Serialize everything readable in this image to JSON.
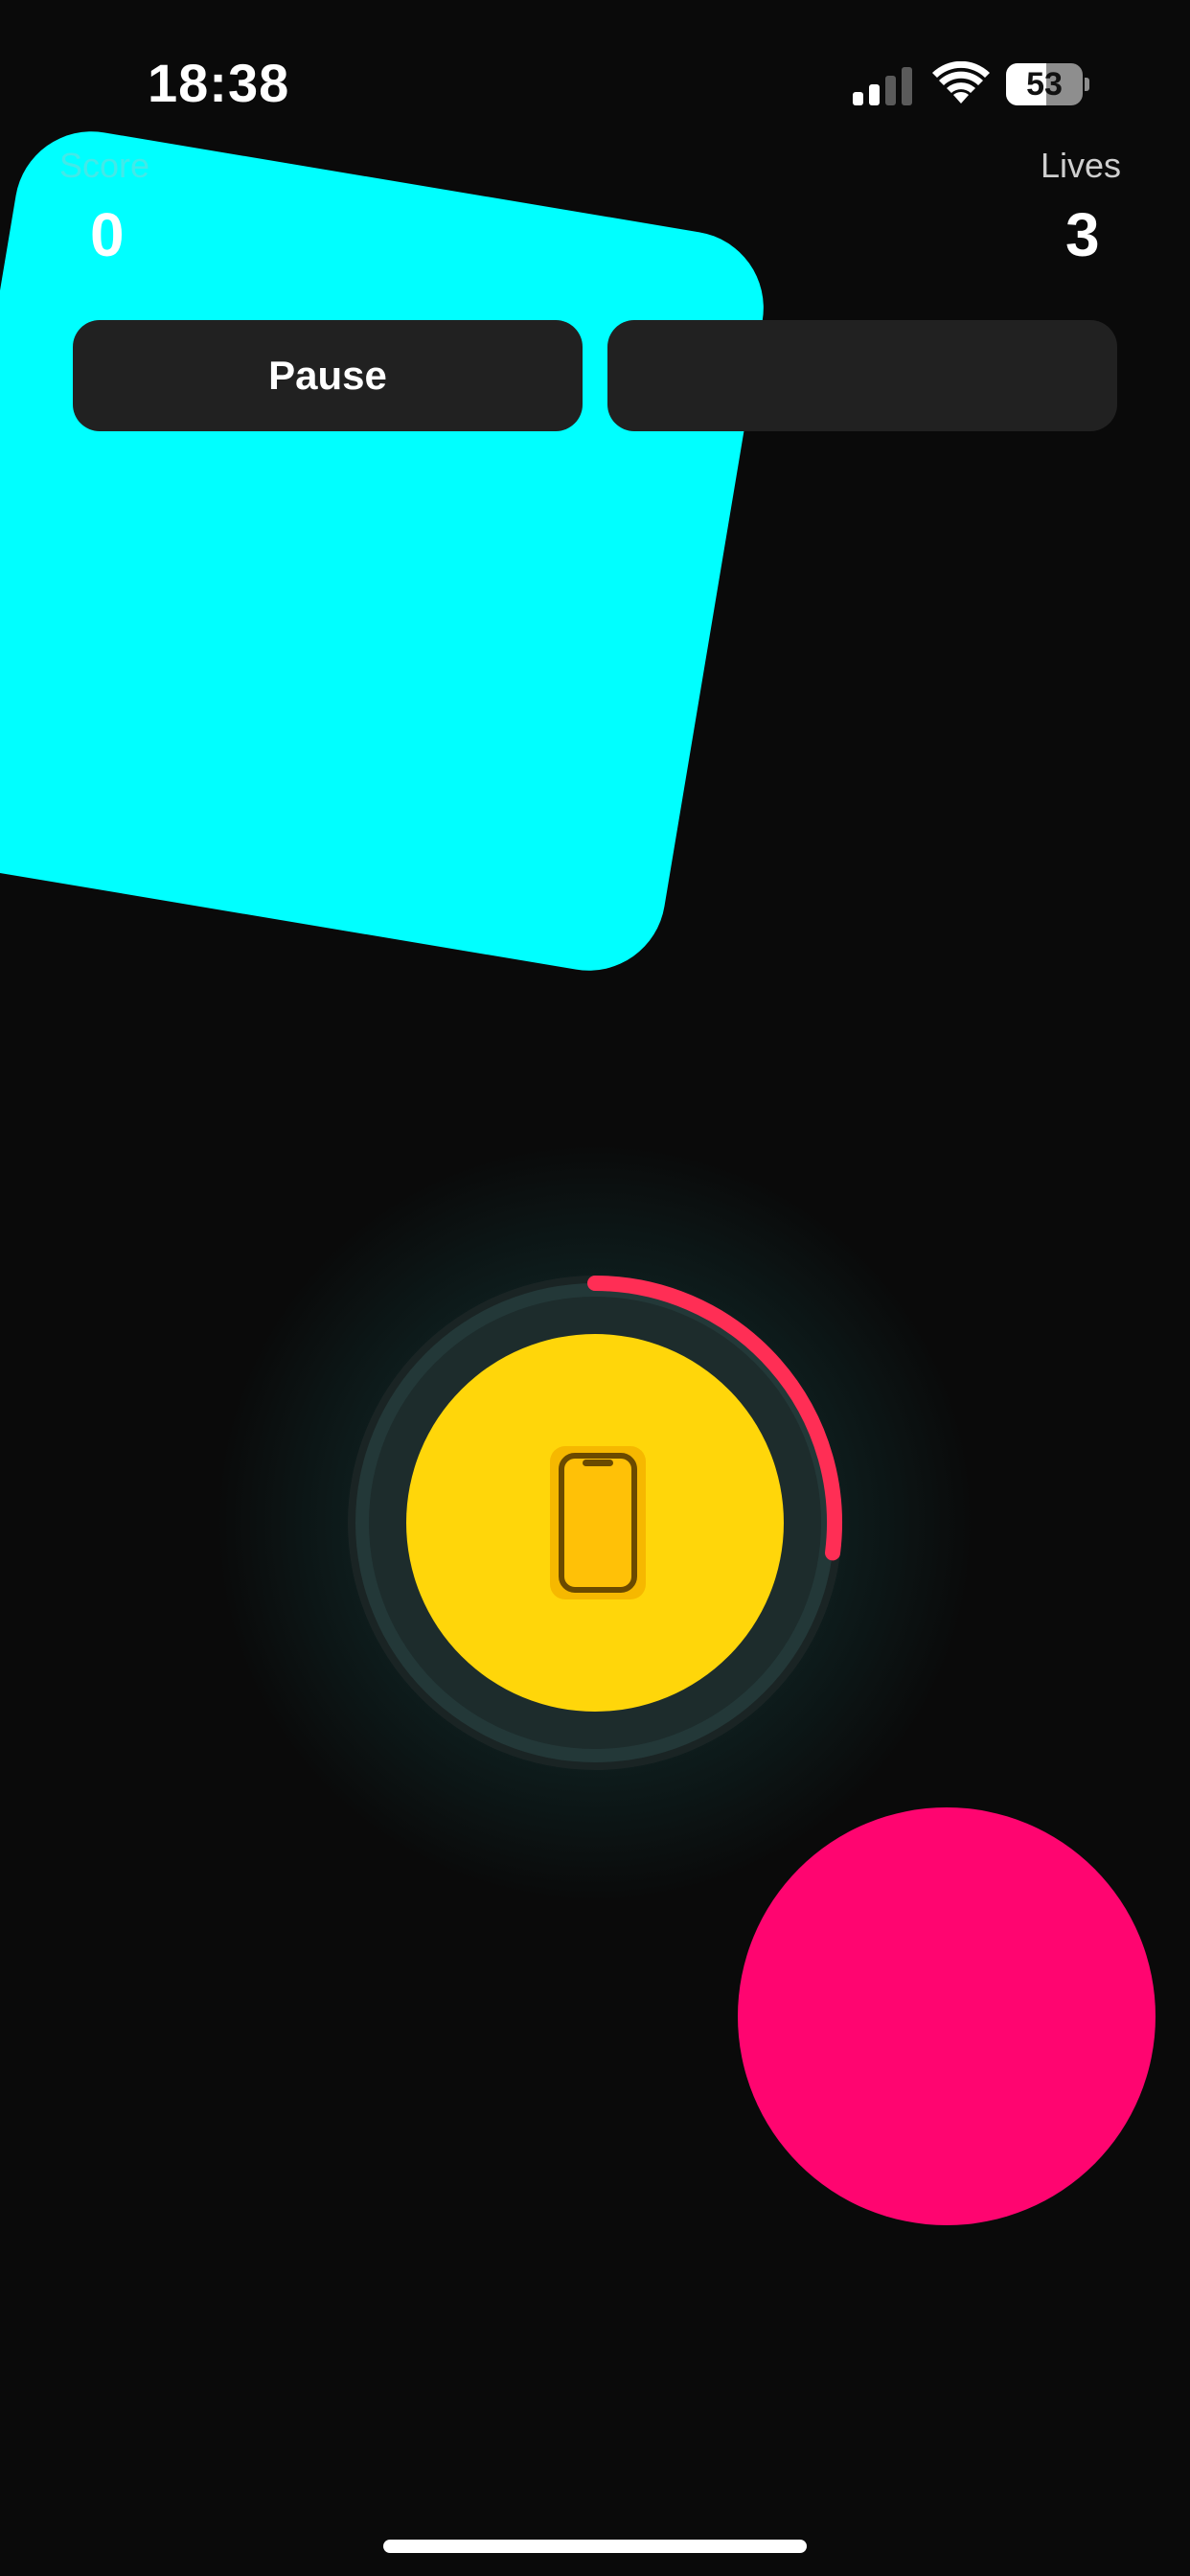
{
  "status_bar": {
    "time": "18:38",
    "battery_level": "53",
    "battery_fraction": 0.53,
    "icons": [
      "cellular-signal-icon",
      "wifi-icon",
      "battery-icon"
    ]
  },
  "hud": {
    "score_label": "Score",
    "score_value": "0",
    "lives_label": "Lives",
    "lives_value": "3"
  },
  "controls": {
    "pause_label": "Pause",
    "second_label": ""
  },
  "game": {
    "timer_fraction": 0.27,
    "center_icon": "phone-icon",
    "colors": {
      "background": "#0a0a0a",
      "cyan_block": "#00ffff",
      "target_core": "#ffd60a",
      "timer_arc": "#ff2e55",
      "pink_ball": "#ff0570",
      "button_bg": "#212121"
    }
  }
}
